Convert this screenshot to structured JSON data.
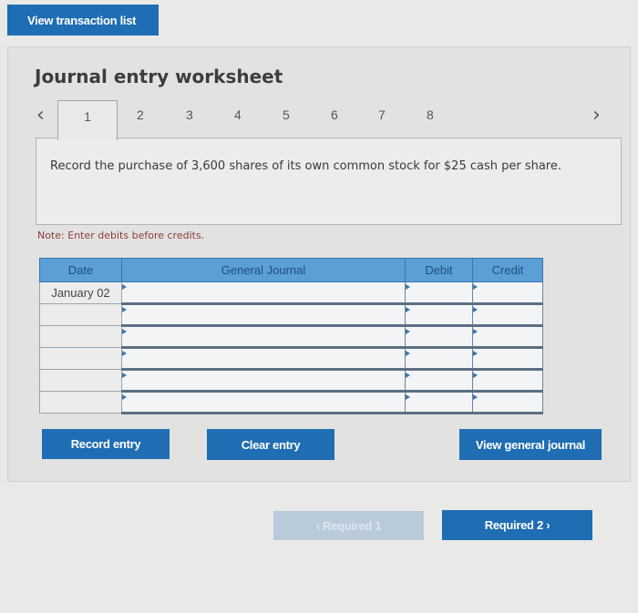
{
  "header": {
    "view_transaction_list": "View transaction list"
  },
  "worksheet": {
    "title": "Journal entry worksheet",
    "tabs": {
      "prev_icon": "‹",
      "next_icon": "›",
      "items": [
        "1",
        "2",
        "3",
        "4",
        "5",
        "6",
        "7",
        "8"
      ],
      "active": "1"
    },
    "question": "Record the purchase of 3,600 shares of its own common stock for $25 cash per share.",
    "note": "Note: Enter debits before credits."
  },
  "journal": {
    "columns": [
      "Date",
      "General Journal",
      "Debit",
      "Credit"
    ],
    "rows": [
      {
        "date": "January 02",
        "account": "",
        "debit": "",
        "credit": ""
      },
      {
        "date": "",
        "account": "",
        "debit": "",
        "credit": ""
      },
      {
        "date": "",
        "account": "",
        "debit": "",
        "credit": ""
      },
      {
        "date": "",
        "account": "",
        "debit": "",
        "credit": ""
      },
      {
        "date": "",
        "account": "",
        "debit": "",
        "credit": ""
      },
      {
        "date": "",
        "account": "",
        "debit": "",
        "credit": ""
      }
    ]
  },
  "actions": {
    "record_entry": "Record entry",
    "clear_entry": "Clear entry",
    "view_general_journal": "View general journal"
  },
  "navigation": {
    "required_1": "‹  Required 1",
    "required_2": "Required 2  ›"
  },
  "colors": {
    "primary_button": "#1f6db3",
    "table_header": "#5a9fd6",
    "disabled_button": "#b9cbdb",
    "note_text": "#8a3d3d"
  }
}
